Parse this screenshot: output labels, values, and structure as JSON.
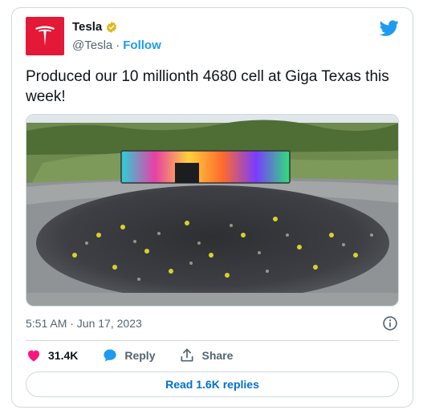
{
  "author": {
    "name": "Tesla",
    "handle": "@Tesla",
    "separator": "·",
    "follow_label": "Follow"
  },
  "tweet": {
    "text": "Produced our 10 millionth 4680 cell at Giga Texas this week!",
    "timestamp": "5:51 AM · Jun 17, 2023"
  },
  "actions": {
    "like_count": "31.4K",
    "reply_label": "Reply",
    "share_label": "Share"
  },
  "read_replies_label": "Read 1.6K replies",
  "colors": {
    "brand_red": "#e31937",
    "twitter_blue": "#1d9bf0",
    "like_pink": "#f91880",
    "link_blue": "#006fd6"
  },
  "icons": {
    "avatar": "tesla-logo",
    "verified": "verified-badge-icon",
    "platform": "twitter-bird-icon",
    "info": "info-icon",
    "like": "heart-icon",
    "reply": "reply-bubble-icon",
    "share": "share-icon"
  }
}
